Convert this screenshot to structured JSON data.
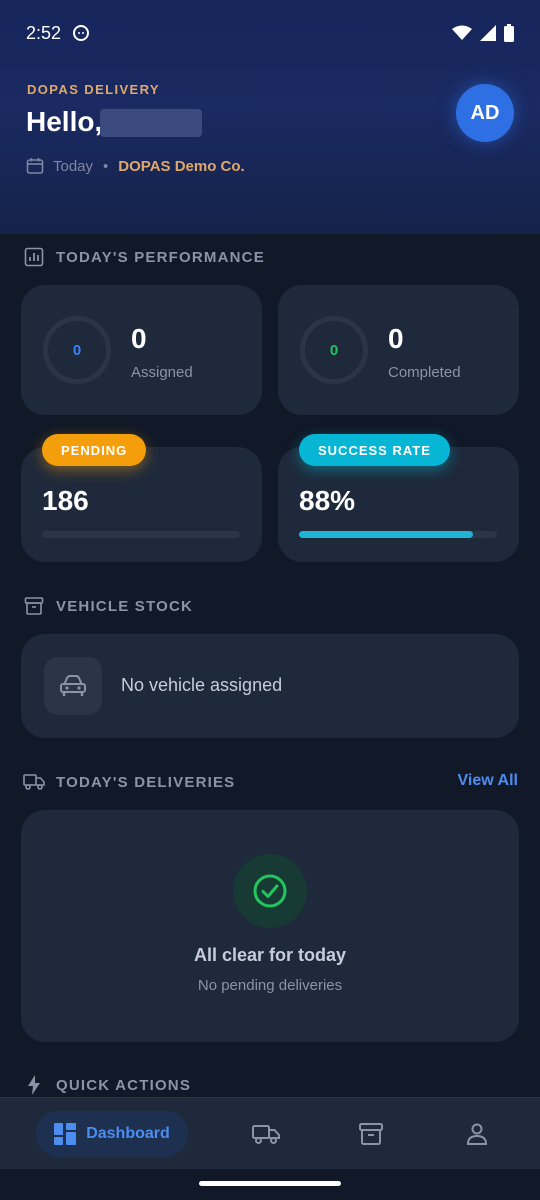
{
  "status_bar": {
    "time": "2:52"
  },
  "header": {
    "eyebrow": "DOPAS DELIVERY",
    "greeting": "Hello,",
    "date_label": "Today",
    "separator": "•",
    "company": "DOPAS Demo Co.",
    "avatar_initials": "AD"
  },
  "performance": {
    "title": "TODAY'S PERFORMANCE",
    "assigned": {
      "ring_value": "0",
      "value": "0",
      "label": "Assigned",
      "ring_color": "#3b82f6"
    },
    "completed": {
      "ring_value": "0",
      "value": "0",
      "label": "Completed",
      "ring_color": "#22c55e"
    },
    "pending": {
      "badge": "PENDING",
      "value": "186",
      "badge_color": "#f59e0b"
    },
    "success_rate": {
      "badge": "SUCCESS RATE",
      "value": "88%",
      "progress": 0.88,
      "badge_color": "#06b6d4"
    }
  },
  "vehicle_stock": {
    "title": "VEHICLE STOCK",
    "empty_text": "No vehicle assigned"
  },
  "deliveries": {
    "title": "TODAY'S DELIVERIES",
    "view_all": "View All",
    "empty_title": "All clear for today",
    "empty_subtitle": "No pending deliveries"
  },
  "quick_actions": {
    "title": "QUICK ACTIONS"
  },
  "bottom_nav": {
    "dashboard": "Dashboard",
    "items": [
      "dashboard-icon",
      "truck-icon",
      "archive-icon",
      "user-icon"
    ],
    "accent": "#4d8df0"
  }
}
